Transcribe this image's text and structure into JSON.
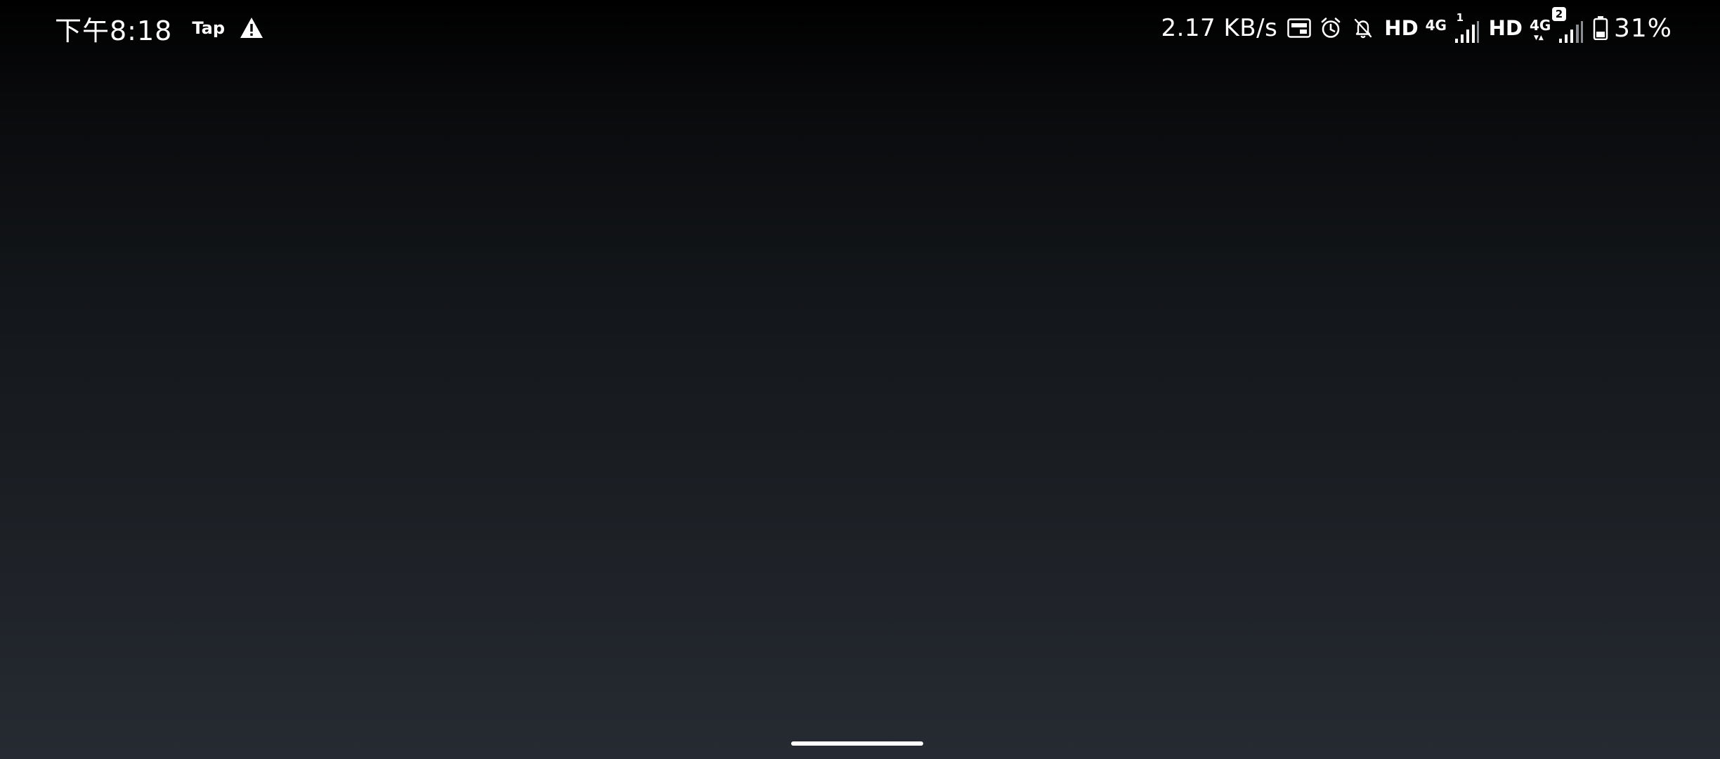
{
  "status_bar": {
    "time": "下午8:18",
    "tap_label": "Tap",
    "net_speed": "2.17 KB/s",
    "sim1": {
      "hd_label": "HD",
      "network_label": "4G",
      "sim_number": "1"
    },
    "sim2": {
      "hd_label": "HD",
      "network_label": "4G",
      "sim_number": "2"
    },
    "battery_percent": "31%"
  },
  "icons": {
    "warning": "warning-icon",
    "auto_hz": "auto-hz-icon",
    "alarm": "alarm-icon",
    "mute": "mute-icon",
    "signal": "signal-icon",
    "battery": "battery-icon"
  },
  "colors": {
    "status_text": "#ffffff",
    "background_top": "#000000",
    "background_bottom": "#262a32"
  }
}
